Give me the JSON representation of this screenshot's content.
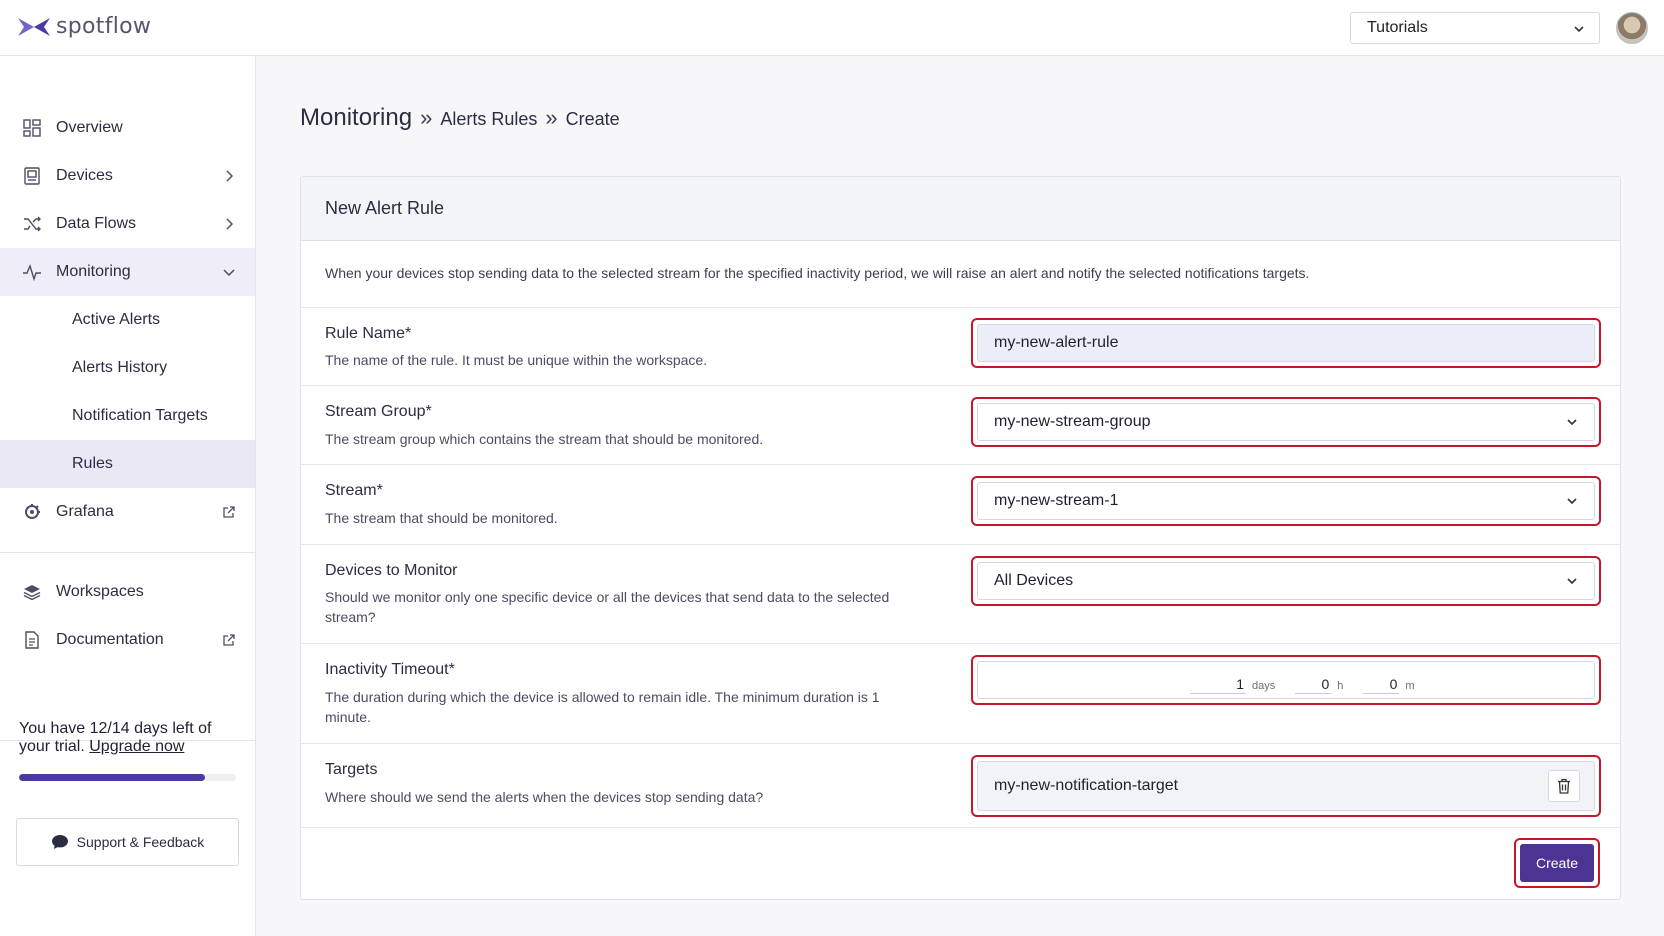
{
  "header": {
    "logo_text": "spotflow",
    "workspace_select": "Tutorials"
  },
  "sidebar": {
    "items": {
      "overview": "Overview",
      "devices": "Devices",
      "data_flows": "Data Flows",
      "monitoring": "Monitoring",
      "active_alerts": "Active Alerts",
      "alerts_history": "Alerts History",
      "notification_targets": "Notification Targets",
      "rules": "Rules",
      "grafana": "Grafana",
      "workspaces": "Workspaces",
      "documentation": "Documentation"
    },
    "trial": {
      "text": "You have 12/14 days left of your trial.",
      "link": "Upgrade now",
      "progress": 0.857
    },
    "support_label": "Support & Feedback"
  },
  "breadcrumb": {
    "main": "Monitoring",
    "sep": "»",
    "level2": "Alerts Rules",
    "level3": "Create"
  },
  "form": {
    "title": "New Alert Rule",
    "description": "When your devices stop sending data to the selected stream for the specified inactivity period, we will raise an alert and notify the selected notifications targets.",
    "rule_name": {
      "label": "Rule Name*",
      "help": "The name of the rule. It must be unique within the workspace.",
      "value": "my-new-alert-rule"
    },
    "stream_group": {
      "label": "Stream Group*",
      "help": "The stream group which contains the stream that should be monitored.",
      "value": "my-new-stream-group"
    },
    "stream": {
      "label": "Stream*",
      "help": "The stream that should be monitored.",
      "value": "my-new-stream-1"
    },
    "devices": {
      "label": "Devices to Monitor",
      "help": "Should we monitor only one specific device or all the devices that send data to the selected stream?",
      "value": "All Devices"
    },
    "timeout": {
      "label": "Inactivity Timeout*",
      "help": "The duration during which the device is allowed to remain idle. The minimum duration is 1 minute.",
      "days": "1",
      "days_unit": "days",
      "hours": "0",
      "hours_unit": "h",
      "minutes": "0",
      "minutes_unit": "m"
    },
    "targets": {
      "label": "Targets",
      "help": "Where should we send the alerts when the devices stop sending data?",
      "value": "my-new-notification-target"
    },
    "create_label": "Create"
  },
  "colors": {
    "accent": "#4b3494",
    "highlight_border": "#c5172b"
  }
}
